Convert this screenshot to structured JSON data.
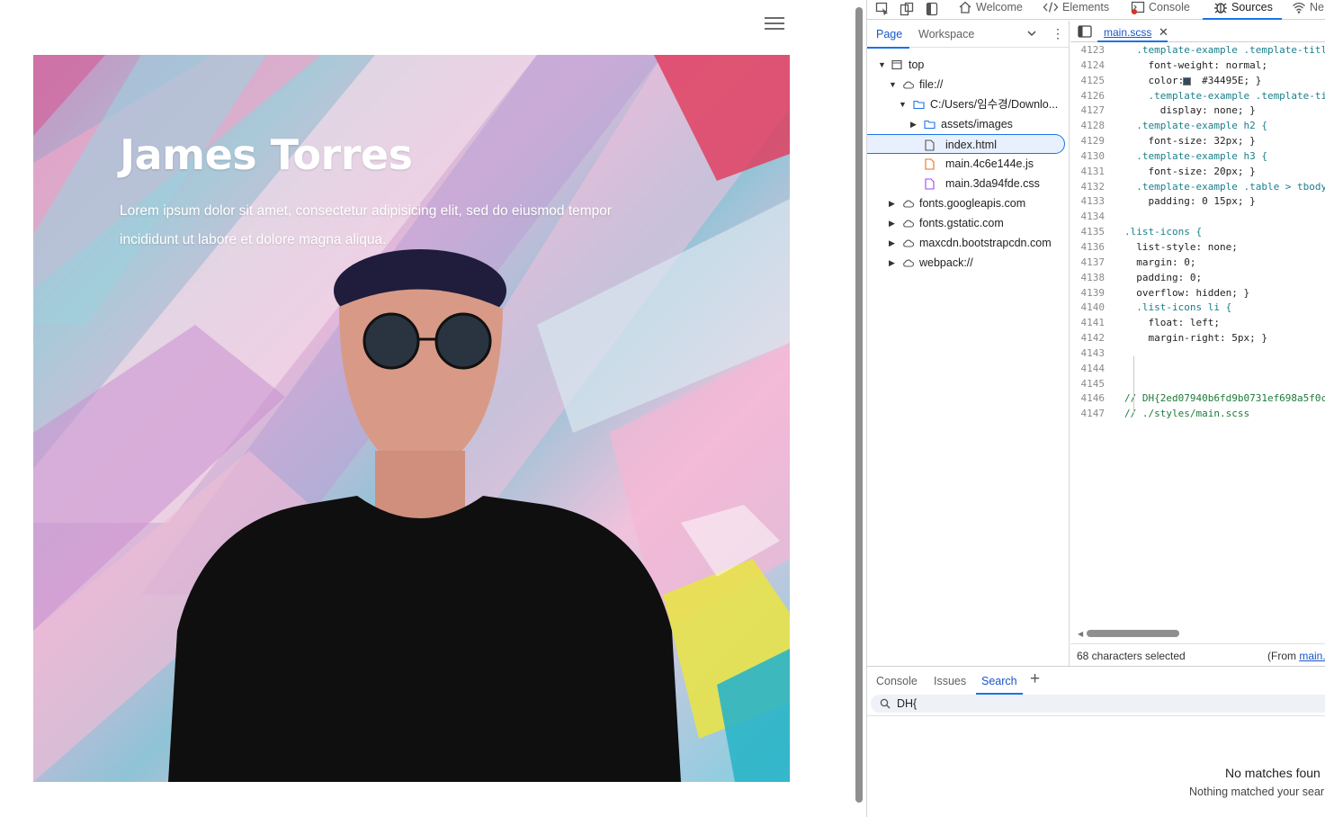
{
  "page": {
    "hero_title": "James Torres",
    "hero_text": "Lorem ipsum dolor sit amet, consectetur adipisicing elit, sed do eiusmod tempor incididunt ut labore et dolore magna aliqua."
  },
  "devtools": {
    "tabs": [
      {
        "label": "Welcome",
        "icon": "home-icon"
      },
      {
        "label": "Elements",
        "icon": "code-brackets-icon"
      },
      {
        "label": "Console",
        "icon": "console-icon"
      },
      {
        "label": "Sources",
        "icon": "bug-icon"
      },
      {
        "label": "Ne",
        "icon": "wifi-icon"
      }
    ],
    "active_tab": "Sources",
    "navigator": {
      "tabs": [
        "Page",
        "Workspace"
      ],
      "tree": [
        {
          "label": "top",
          "icon": "frame-icon",
          "expanded": true
        },
        {
          "label": "file://",
          "icon": "cloud-icon",
          "expanded": true
        },
        {
          "label": "C:/Users/임수경/Downlo...",
          "icon": "folder-icon",
          "expanded": true
        },
        {
          "label": "assets/images",
          "icon": "folder-icon",
          "expanded": false
        },
        {
          "label": "index.html",
          "icon": "file-icon",
          "selected": true
        },
        {
          "label": "main.4c6e144e.js",
          "icon": "file-js-icon"
        },
        {
          "label": "main.3da94fde.css",
          "icon": "file-css-icon"
        },
        {
          "label": "fonts.googleapis.com",
          "icon": "cloud-icon",
          "expanded": false
        },
        {
          "label": "fonts.gstatic.com",
          "icon": "cloud-icon",
          "expanded": false
        },
        {
          "label": "maxcdn.bootstrapcdn.com",
          "icon": "cloud-icon",
          "expanded": false
        },
        {
          "label": "webpack://",
          "icon": "cloud-icon",
          "expanded": false
        }
      ]
    },
    "editor": {
      "file_tab": "main.scss",
      "lines": [
        {
          "n": "4123",
          "code": "  .template-example .template-titl"
        },
        {
          "n": "4124",
          "code": "    font-weight: normal;"
        },
        {
          "n": "4125",
          "code": "    color:   #34495E; }"
        },
        {
          "n": "4126",
          "code": "    .template-example .template-ti"
        },
        {
          "n": "4127",
          "code": "      display: none; }"
        },
        {
          "n": "4128",
          "code": "  .template-example h2 {"
        },
        {
          "n": "4129",
          "code": "    font-size: 32px; }"
        },
        {
          "n": "4130",
          "code": "  .template-example h3 {"
        },
        {
          "n": "4131",
          "code": "    font-size: 20px; }"
        },
        {
          "n": "4132",
          "code": "  .template-example .table > tbody"
        },
        {
          "n": "4133",
          "code": "    padding: 0 15px; }"
        },
        {
          "n": "4134",
          "code": ""
        },
        {
          "n": "4135",
          "code": ".list-icons {"
        },
        {
          "n": "4136",
          "code": "  list-style: none;"
        },
        {
          "n": "4137",
          "code": "  margin: 0;"
        },
        {
          "n": "4138",
          "code": "  padding: 0;"
        },
        {
          "n": "4139",
          "code": "  overflow: hidden; }"
        },
        {
          "n": "4140",
          "code": "  .list-icons li {"
        },
        {
          "n": "4141",
          "code": "    float: left;"
        },
        {
          "n": "4142",
          "code": "    margin-right: 5px; }"
        },
        {
          "n": "4143",
          "code": ""
        },
        {
          "n": "4144",
          "code": ""
        },
        {
          "n": "4145",
          "code": ""
        },
        {
          "n": "4146",
          "code": "// DH{2ed07940b6fd9b0731ef698a5f0c"
        },
        {
          "n": "4147",
          "code": "// ./styles/main.scss"
        }
      ],
      "color_swatch": "#34495E",
      "status_left": "68 characters selected",
      "status_right_prefix": "(From ",
      "status_right_link": "main."
    },
    "drawer": {
      "tabs": [
        "Console",
        "Issues",
        "Search"
      ],
      "active_tab": "Search",
      "search_value": "DH{",
      "no_match_title": "No matches foun",
      "no_match_sub": "Nothing matched your sear"
    }
  }
}
